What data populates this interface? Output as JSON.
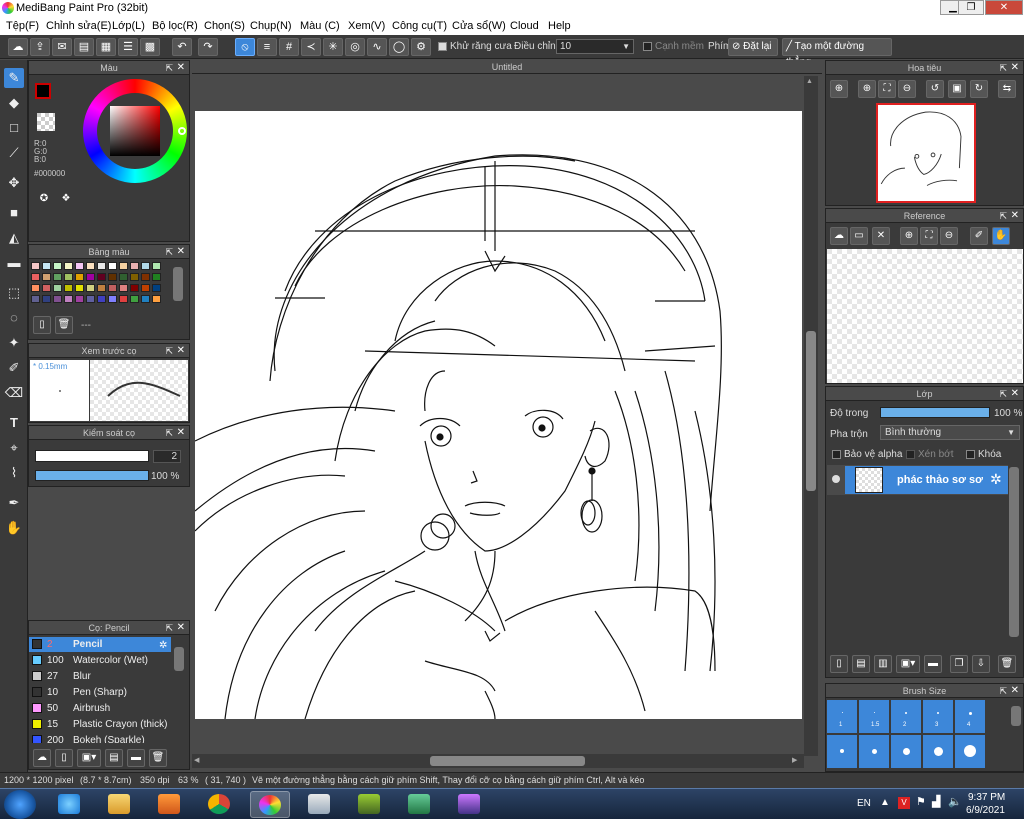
{
  "window": {
    "title": "MediBang Paint Pro (32bit)",
    "minimize": "▁",
    "maximize": "❐",
    "close": "✕"
  },
  "menu": [
    "Tệp(F)",
    "Chỉnh sửa(E)",
    "Lớp(L)",
    "Bộ lọc(R)",
    "Chọn(S)",
    "Chụp(N)",
    "Màu (C)",
    "Xem(V)",
    "Công cụ(T)",
    "Cửa sổ(W)",
    "Cloud",
    "Help"
  ],
  "toolbar": {
    "antialias_label": "Khử răng cưa",
    "adjust_label": "Điều chỉnh",
    "adjust_value": "10",
    "soft_edge_label": "Cạnh mềm",
    "key_label": "Phím",
    "reset_label": "Đặt lại",
    "line_label": "Tạo một đường thẳng"
  },
  "color_panel": {
    "title": "Màu",
    "r": "R:0",
    "g": "G:0",
    "b": "B:0",
    "hex": "#000000"
  },
  "palette_panel": {
    "title": "Bảng màu",
    "empty_label": "---",
    "colors": [
      "#f4c6c6",
      "#c6e6f4",
      "#c6f4c6",
      "#f4f4c6",
      "#f4c6f4",
      "#fbe0c0",
      "#e8e8e8",
      "#ffffff",
      "#f4d0a0",
      "#e8b0b0",
      "#b0d8e8",
      "#b0e8b0",
      "#e86060",
      "#d0a070",
      "#60a060",
      "#a0c060",
      "#e0a000",
      "#a000a0",
      "#600020",
      "#603000",
      "#306030",
      "#806000",
      "#803000",
      "#208020",
      "#ff9060",
      "#d06060",
      "#a0d0a0",
      "#c0c000",
      "#e0e000",
      "#d0d080",
      "#c08040",
      "#c06060",
      "#e08080",
      "#800000",
      "#c04000",
      "#004080",
      "#606090",
      "#304080",
      "#805090",
      "#c080c0",
      "#a040a0",
      "#6060a0",
      "#4040c0",
      "#8080ff",
      "#e04040",
      "#40a040",
      "#2080c0",
      "#ffa040"
    ]
  },
  "brush_preview_panel": {
    "title": "Xem trước cọ",
    "size": "* 0.15mm"
  },
  "brush_control_panel": {
    "title": "Kiểm soát cọ",
    "size_value": "2",
    "opacity_value": "100 %"
  },
  "brush_list_panel": {
    "title": "Cọ: Pencil",
    "items": [
      {
        "size": "2",
        "name": "Pencil",
        "color": "#333333",
        "selected": true
      },
      {
        "size": "100",
        "name": "Watercolor (Wet)",
        "color": "#66ccff",
        "selected": false
      },
      {
        "size": "27",
        "name": "Blur",
        "color": "#cccccc",
        "selected": false
      },
      {
        "size": "10",
        "name": "Pen (Sharp)",
        "color": "#333333",
        "selected": false
      },
      {
        "size": "50",
        "name": "Airbrush",
        "color": "#ff99ff",
        "selected": false
      },
      {
        "size": "15",
        "name": "Plastic Crayon (thick)",
        "color": "#eeee00",
        "selected": false
      },
      {
        "size": "200",
        "name": "Bokeh (Sparkle)",
        "color": "#3355ff",
        "selected": false
      }
    ]
  },
  "canvas": {
    "tab_title": "Untitled"
  },
  "navigator_panel": {
    "title": "Hoa tiêu"
  },
  "reference_panel": {
    "title": "Reference"
  },
  "layer_panel": {
    "title": "Lớp",
    "opacity_label": "Độ trong",
    "opacity_value": "100 %",
    "opacity_fraction": 1.0,
    "blend_label": "Pha trộn",
    "blend_value": "Bình thường",
    "protect_alpha": "Bảo vệ alpha",
    "clipping": "Xén bớt",
    "lock": "Khóa",
    "layers": [
      {
        "name": "phác thảo sơ sơ",
        "selected": true
      }
    ]
  },
  "brush_size_panel": {
    "title": "Brush Size",
    "row1": [
      ".",
      ".",
      ".",
      ".",
      "."
    ],
    "row1_labels": [
      "1",
      "1.5",
      "2",
      "3",
      "4"
    ]
  },
  "status": {
    "size": "1200 * 1200 pixel",
    "cm": "(8.7 * 8.7cm)",
    "dpi": "350 dpi",
    "zoom": "63 %",
    "coords": "( 31, 740 )",
    "hint": "Vẽ một đường thẳng bằng cách giữ phím Shift, Thay đổi cỡ cọ bằng cách giữ phím Ctrl, Alt và kéo"
  },
  "taskbar": {
    "lang": "EN",
    "time": "9:37 PM",
    "date": "6/9/2021"
  }
}
